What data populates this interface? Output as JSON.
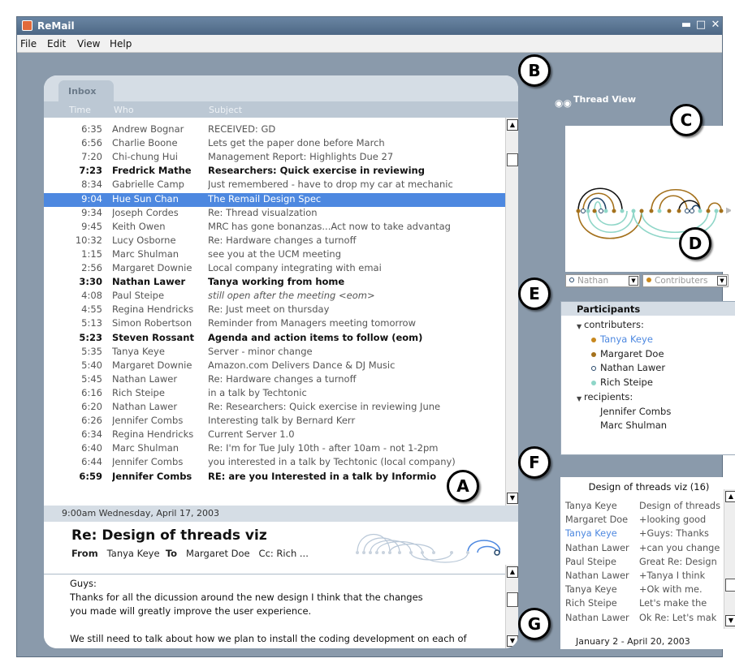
{
  "window": {
    "title": "ReMail"
  },
  "menu": [
    "File",
    "Edit",
    "View",
    "Help"
  ],
  "inbox": {
    "tab": "Inbox",
    "columns": {
      "time": "Time",
      "who": "Who",
      "subject": "Subject"
    },
    "rows": [
      {
        "time": "6:35",
        "who": "Andrew Bognar",
        "subject": "RECEIVED: GD"
      },
      {
        "time": "6:56",
        "who": "Charlie Boone",
        "subject": "Lets get the paper done before March"
      },
      {
        "time": "7:20",
        "who": "Chi-chung Hui",
        "subject": "Management Report: Highlights Due 27"
      },
      {
        "time": "7:23",
        "who": "Fredrick Mathe",
        "subject": "Researchers: Quick exercise in reviewing",
        "style": "bold"
      },
      {
        "time": "8:34",
        "who": "Gabrielle Camp",
        "subject": "Just remembered - have to drop my car at mechanic"
      },
      {
        "time": "9:04",
        "who": "Hue Sun Chan",
        "subject": "The Remail Design Spec",
        "style": "selected"
      },
      {
        "time": "9:34",
        "who": "Joseph Cordes",
        "subject": "Re: Thread visualzation"
      },
      {
        "time": "9:45",
        "who": "Keith Owen",
        "subject": "MRC has gone bonanzas...Act now to take advantag"
      },
      {
        "time": "10:32",
        "who": "Lucy Osborne",
        "subject": "Re: Hardware changes a turnoff"
      },
      {
        "time": "1:15",
        "who": "Marc Shulman",
        "subject": "see you at the UCM meeting"
      },
      {
        "time": "2:56",
        "who": "Margaret Downie",
        "subject": "Local company integrating with emai"
      },
      {
        "time": "3:30",
        "who": "Nathan Lawer",
        "subject": "Tanya working from home",
        "style": "bold"
      },
      {
        "time": "4:08",
        "who": "Paul Steipe",
        "subject": "still open after the meeting <eom>",
        "style": "italic"
      },
      {
        "time": "4:55",
        "who": "Regina Hendricks",
        "subject": "Re: Just meet on thursday"
      },
      {
        "time": "5:13",
        "who": "Simon Robertson",
        "subject": "Reminder from Managers meeting tomorrow"
      },
      {
        "time": "5:23",
        "who": "Steven Rossant",
        "subject": "Agenda and action items to follow (eom)",
        "style": "bold"
      },
      {
        "time": "5:35",
        "who": "Tanya Keye",
        "subject": "Server - minor change"
      },
      {
        "time": "5:40",
        "who": "Margaret Downie",
        "subject": "Amazon.com Delivers Dance & DJ Music"
      },
      {
        "time": "5:45",
        "who": "Nathan Lawer",
        "subject": "Re: Hardware changes a turnoff"
      },
      {
        "time": "6:16",
        "who": "Rich Steipe",
        "subject": "in a talk by Techtonic"
      },
      {
        "time": "6:20",
        "who": "Nathan Lawer",
        "subject": "Re: Researchers: Quick exercise in reviewing June"
      },
      {
        "time": "6:26",
        "who": "Jennifer Combs",
        "subject": "Interesting talk by Bernard Kerr"
      },
      {
        "time": "6:34",
        "who": "Regina Hendricks",
        "subject": "Current Server 1.0"
      },
      {
        "time": "6:40",
        "who": "Marc Shulman",
        "subject": "Re: I'm for Tue July 10th - after 10am - not 1-2pm"
      },
      {
        "time": "6:44",
        "who": "Jennifer Combs",
        "subject": "you interested in a talk by Techtonic (local company)"
      },
      {
        "time": "6:59",
        "who": "Jennifer Combs",
        "subject": "RE: are you Interested in a talk by Informio",
        "style": "bold"
      }
    ]
  },
  "message": {
    "date": "9:00am Wednesday, April 17, 2003",
    "subject": "Re: Design of threads viz",
    "from_label": "From",
    "from": "Tanya Keye",
    "to_label": "To",
    "to": "Margaret Doe",
    "cc": "Cc: Rich ...",
    "body": [
      "Guys:",
      "Thanks for all the dicussion around the new design I think that the changes",
      "you made will greatly improve the user experience.",
      "",
      "We still need to talk about how we plan to install the coding development on each of"
    ]
  },
  "thread_view": {
    "title": "Thread View",
    "filter_person": "Nathan",
    "filter_role": "Contributers"
  },
  "participants": {
    "title": "Participants",
    "contributers_label": "contributers:",
    "contributers": [
      {
        "name": "Tanya Keye",
        "color": "#c8881e",
        "highlight": true
      },
      {
        "name": "Margaret Doe",
        "color": "#a4711c"
      },
      {
        "name": "Nathan Lawer",
        "color": "open"
      },
      {
        "name": "Rich Steipe",
        "color": "#8fd6c8"
      }
    ],
    "recipients_label": "recipients:",
    "recipients": [
      "Jennifer Combs",
      "Marc Shulman"
    ]
  },
  "thread": {
    "title": "Design of threads viz (16)",
    "rows": [
      {
        "who": "Tanya Keye",
        "snippet": "Design of threads"
      },
      {
        "who": "Margaret Doe",
        "snippet": "+looking good"
      },
      {
        "who": "Tanya Keye",
        "snippet": "+Guys: Thanks",
        "highlight": true
      },
      {
        "who": "Nathan Lawer",
        "snippet": "+can you change"
      },
      {
        "who": "Paul Steipe",
        "snippet": "Great Re: Design"
      },
      {
        "who": "Nathan Lawer",
        "snippet": "+Tanya I think"
      },
      {
        "who": "Tanya Keye",
        "snippet": "+Ok with me."
      },
      {
        "who": "Rich Steipe",
        "snippet": "Let's make the"
      },
      {
        "who": "Nathan Lawer",
        "snippet": "Ok Re: Let's mak"
      }
    ],
    "date_range": "January 2 - April 20, 2003"
  },
  "callouts": [
    "A",
    "B",
    "C",
    "D",
    "E",
    "F",
    "G"
  ]
}
